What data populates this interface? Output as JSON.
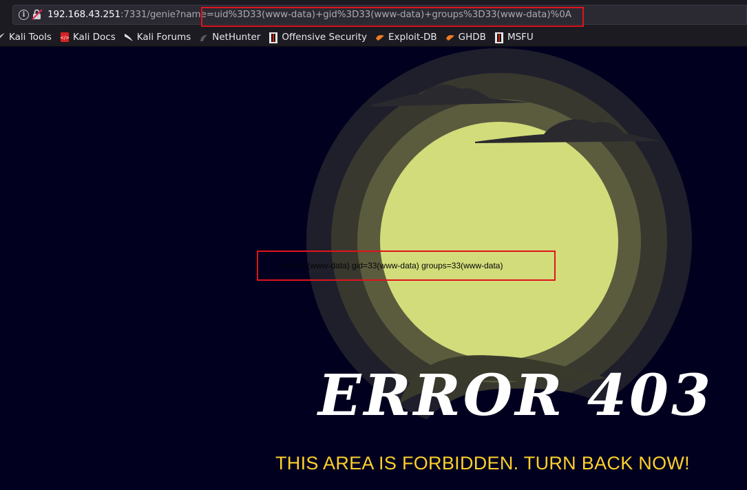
{
  "browser": {
    "url_host": "192.168.43.251",
    "url_rest": ":7331/genie?name=uid%3D33(www-data)+gid%3D33(www-data)+groups%3D33(www-data)%0A",
    "bookmarks": [
      {
        "label": "Kali Tools",
        "icon": "kali-dragon-icon"
      },
      {
        "label": "Kali Docs",
        "icon": "kali-docs-icon"
      },
      {
        "label": "Kali Forums",
        "icon": "kali-dragon-icon"
      },
      {
        "label": "NetHunter",
        "icon": "nethunter-icon"
      },
      {
        "label": "Offensive Security",
        "icon": "offsec-icon"
      },
      {
        "label": "Exploit-DB",
        "icon": "exploit-db-icon"
      },
      {
        "label": "GHDB",
        "icon": "ghdb-icon"
      },
      {
        "label": "MSFU",
        "icon": "offsec-icon"
      }
    ]
  },
  "page": {
    "command_output": "uid=33(www-data) gid=33(www-data) groups=33(www-data)",
    "error_title": "ERROR 403",
    "error_subtitle": "THIS AREA IS FORBIDDEN. TURN BACK NOW!"
  },
  "colors": {
    "background": "#01001f",
    "moon": "#d2dc7a",
    "subtitle": "#ffd02b",
    "annotation": "#e0141c"
  }
}
